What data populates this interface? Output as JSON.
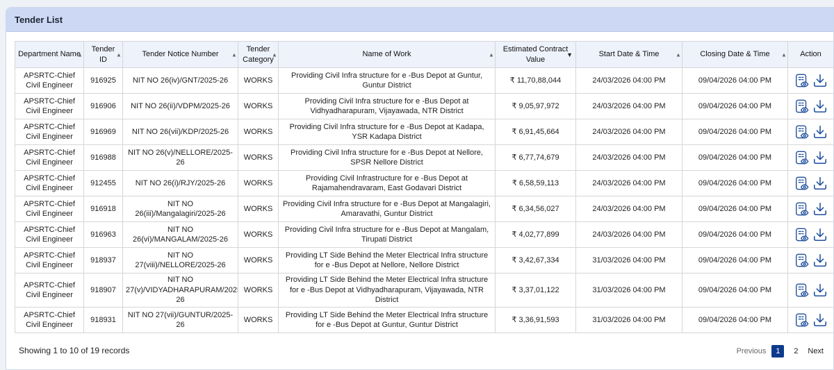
{
  "panel": {
    "title": "Tender List"
  },
  "table": {
    "headers": [
      {
        "label": "Department Name",
        "sort": "both"
      },
      {
        "label": "Tender ID",
        "sort": "both"
      },
      {
        "label": "Tender Notice Number",
        "sort": "both"
      },
      {
        "label": "Tender Category",
        "sort": "both"
      },
      {
        "label": "Name of Work",
        "sort": "both"
      },
      {
        "label": "Estimated Contract Value",
        "sort": "desc"
      },
      {
        "label": "Start Date & Time",
        "sort": "both"
      },
      {
        "label": "Closing Date & Time",
        "sort": "both"
      },
      {
        "label": "Action",
        "sort": "none"
      }
    ],
    "rows": [
      {
        "dept": "APSRTC-Chief Civil Engineer",
        "id": "916925",
        "notice": "NIT NO 26(iv)/GNT/2025-26",
        "category": "WORKS",
        "work": "Providing Civil Infra structure for e -Bus Depot at Guntur, Guntur District",
        "value": "₹ 11,70,88,044",
        "start": "24/03/2026 04:00 PM",
        "close": "09/04/2026 04:00 PM"
      },
      {
        "dept": "APSRTC-Chief Civil Engineer",
        "id": "916906",
        "notice": "NIT NO 26(ii)/VDPM/2025-26",
        "category": "WORKS",
        "work": "Providing Civil Infra structure for e -Bus Depot at Vidhyadharapuram, Vijayawada, NTR District",
        "value": "₹ 9,05,97,972",
        "start": "24/03/2026 04:00 PM",
        "close": "09/04/2026 04:00 PM"
      },
      {
        "dept": "APSRTC-Chief Civil Engineer",
        "id": "916969",
        "notice": "NIT NO 26(vii)/KDP/2025-26",
        "category": "WORKS",
        "work": "Providing Civil Infra structure for e -Bus Depot at Kadapa, YSR Kadapa District",
        "value": "₹ 6,91,45,664",
        "start": "24/03/2026 04:00 PM",
        "close": "09/04/2026 04:00 PM"
      },
      {
        "dept": "APSRTC-Chief Civil Engineer",
        "id": "916988",
        "notice": "NIT NO 26(v)/NELLORE/2025-26",
        "category": "WORKS",
        "work": "Providing Civil Infra structure for e -Bus Depot at Nellore, SPSR Nellore District",
        "value": "₹ 6,77,74,679",
        "start": "24/03/2026 04:00 PM",
        "close": "09/04/2026 04:00 PM"
      },
      {
        "dept": "APSRTC-Chief Civil Engineer",
        "id": "912455",
        "notice": "NIT NO 26(i)/RJY/2025-26",
        "category": "WORKS",
        "work": "Providing Civil Infrastructure for e -Bus Depot at Rajamahendravaram, East Godavari District",
        "value": "₹ 6,58,59,113",
        "start": "24/03/2026 04:00 PM",
        "close": "09/04/2026 04:00 PM"
      },
      {
        "dept": "APSRTC-Chief Civil Engineer",
        "id": "916918",
        "notice": "NIT NO 26(iii)/Mangalagiri/2025-26",
        "category": "WORKS",
        "work": "Providing Civil Infra structure for e -Bus Depot at Mangalagiri, Amaravathi, Guntur District",
        "value": "₹ 6,34,56,027",
        "start": "24/03/2026 04:00 PM",
        "close": "09/04/2026 04:00 PM"
      },
      {
        "dept": "APSRTC-Chief Civil Engineer",
        "id": "916963",
        "notice": "NIT NO 26(vi)/MANGALAM/2025-26",
        "category": "WORKS",
        "work": "Providing Civil Infra structure for e -Bus Depot at Mangalam, Tirupati District",
        "value": "₹ 4,02,77,899",
        "start": "24/03/2026 04:00 PM",
        "close": "09/04/2026 04:00 PM"
      },
      {
        "dept": "APSRTC-Chief Civil Engineer",
        "id": "918937",
        "notice": "NIT NO 27(viii)/NELLORE/2025-26",
        "category": "WORKS",
        "work": "Providing LT Side Behind the Meter Electrical Infra structure for e -Bus Depot at Nellore, Nellore District",
        "value": "₹ 3,42,67,334",
        "start": "31/03/2026 04:00 PM",
        "close": "09/04/2026 04:00 PM"
      },
      {
        "dept": "APSRTC-Chief Civil Engineer",
        "id": "918907",
        "notice": "NIT NO 27(v)/VIDYADHARAPURAM/2025-26",
        "category": "WORKS",
        "work": "Providing LT Side Behind the Meter Electrical Infra structure for e -Bus Depot at Vidhyadharapuram, Vijayawada, NTR District",
        "value": "₹ 3,37,01,122",
        "start": "31/03/2026 04:00 PM",
        "close": "09/04/2026 04:00 PM",
        "tall": true
      },
      {
        "dept": "APSRTC-Chief Civil Engineer",
        "id": "918931",
        "notice": "NIT NO 27(vii)/GUNTUR/2025-26",
        "category": "WORKS",
        "work": "Providing LT Side Behind the Meter Electrical Infra structure for e -Bus Depot at Guntur, Guntur District",
        "value": "₹ 3,36,91,593",
        "start": "31/03/2026 04:00 PM",
        "close": "09/04/2026 04:00 PM"
      }
    ],
    "action_icons": [
      "view-document-icon",
      "download-icon"
    ],
    "icon_color": "#1f4e9c"
  },
  "footer": {
    "info": "Showing 1 to 10 of 19 records",
    "pagination": {
      "previous": "Previous",
      "pages": [
        "1",
        "2"
      ],
      "current": "1",
      "next": "Next"
    }
  }
}
